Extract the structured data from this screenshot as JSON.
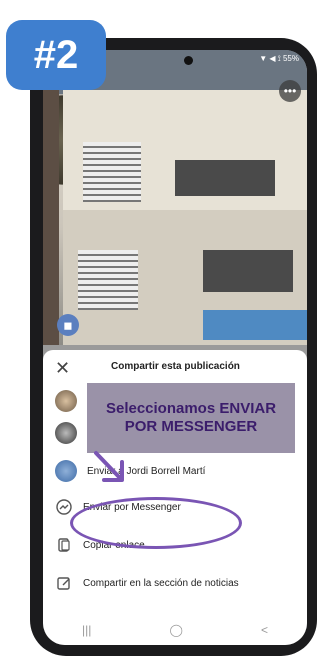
{
  "badge": "#2",
  "status": {
    "right": "▼ ◀ ⟟ 55%"
  },
  "post": {
    "more_label": "•••"
  },
  "share_sheet": {
    "title": "Compartir esta publicación",
    "close_label": "✕",
    "rows": [
      {
        "label": "Enviar a Jordi Borrell Martí"
      },
      {
        "label": "Enviar por Messenger"
      },
      {
        "label": "Copiar enlace"
      },
      {
        "label": "Compartir en la sección de noticias"
      }
    ]
  },
  "callout": "Seleccionamos ENVIAR POR MESSENGER",
  "nav": {
    "recents": "|||",
    "home": "◯",
    "back": "<"
  },
  "colors": {
    "badge": "#3f7fcf",
    "callout_bg": "#9a92a8",
    "callout_text": "#3b1d6b",
    "highlight": "#7a55b4"
  },
  "icons": [
    "messenger-icon",
    "copy-link-icon",
    "edit-post-icon",
    "close-icon",
    "more-icon"
  ]
}
